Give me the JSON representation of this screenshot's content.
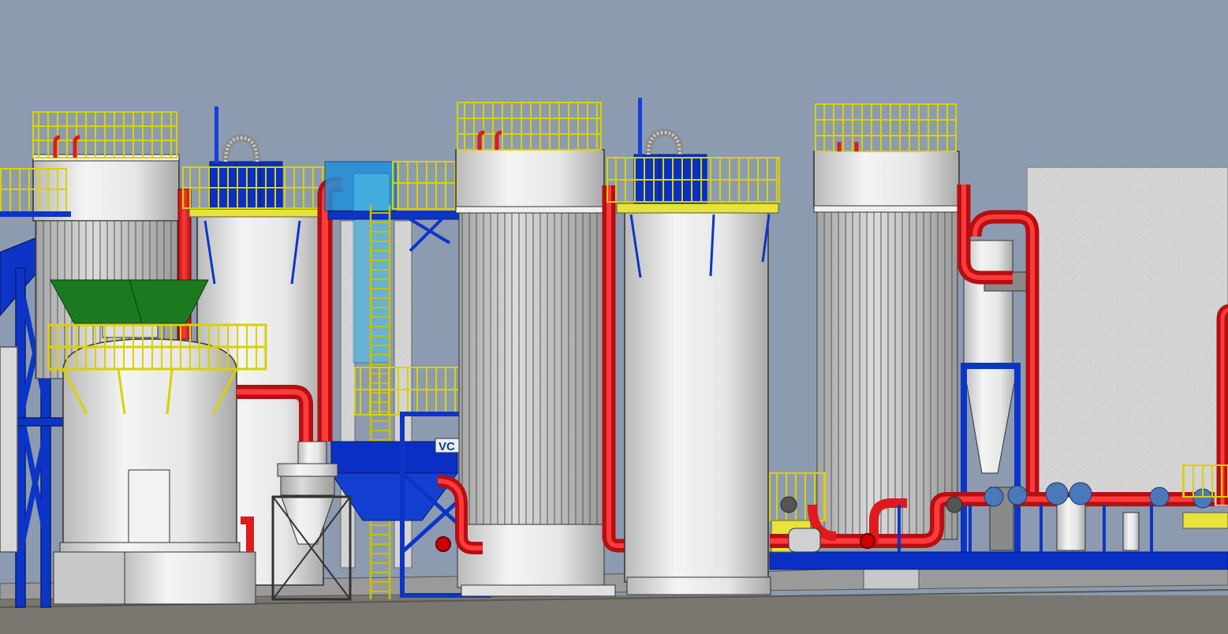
{
  "scene": {
    "signage": {
      "skid_label": "VC"
    },
    "colors": {
      "sky": "#8c9bb0",
      "ground": "#7a7670",
      "vessel_white": "#ececec",
      "vessel_grey": "#c9c9c9",
      "steel_blue": "#0a2fc4",
      "pipe_red": "#e0191c",
      "rail_yellow": "#e8e23a",
      "hopper_green": "#1b7a1f",
      "wall_grey": "#d6d6d6"
    },
    "icons": [
      "vessel",
      "cyclone-separator",
      "ladder",
      "handrail",
      "valve",
      "flexible-hose"
    ]
  }
}
